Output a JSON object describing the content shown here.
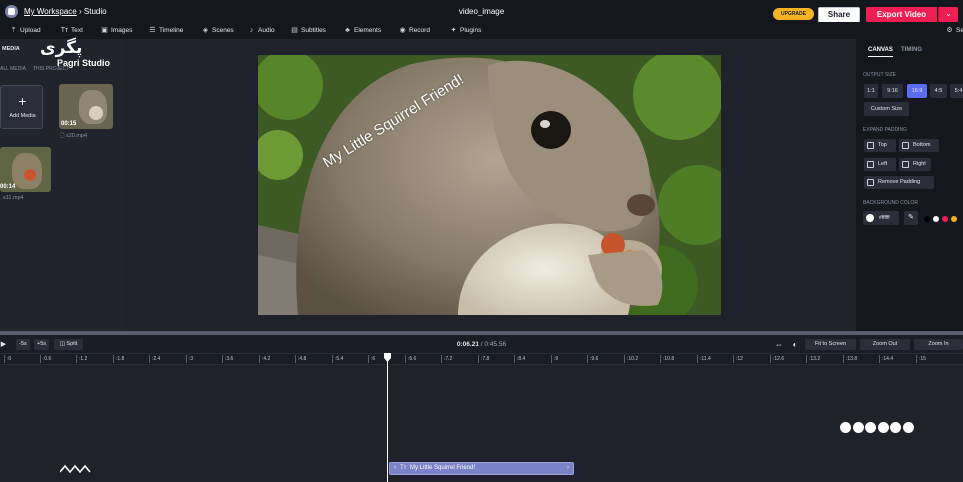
{
  "header": {
    "workspace_link": "My Workspace",
    "crumb_separator": "›",
    "crumb_current": "Studio",
    "document_title": "video_image",
    "upgrade_label": "UPGRADE",
    "share_label": "Share",
    "export_label": "Export Video",
    "export_dropdown": "⌄"
  },
  "toolbar": [
    {
      "id": "upload",
      "label": "Upload",
      "icon": "upload-icon",
      "glyph": "⤒"
    },
    {
      "id": "text",
      "label": "Text",
      "icon": "text-icon",
      "glyph": "Tт"
    },
    {
      "id": "images",
      "label": "Images",
      "icon": "images-icon",
      "glyph": "▣"
    },
    {
      "id": "timeline",
      "label": "Timeline",
      "icon": "timeline-icon",
      "glyph": "☰"
    },
    {
      "id": "scenes",
      "label": "Scenes",
      "icon": "scenes-icon",
      "glyph": "◈"
    },
    {
      "id": "audio",
      "label": "Audio",
      "icon": "music-note-icon",
      "glyph": "♪"
    },
    {
      "id": "subtitles",
      "label": "Subtitles",
      "icon": "subtitles-icon",
      "glyph": "▤"
    },
    {
      "id": "elements",
      "label": "Elements",
      "icon": "elements-icon",
      "glyph": "♣"
    },
    {
      "id": "record",
      "label": "Record",
      "icon": "record-icon",
      "glyph": "◉"
    },
    {
      "id": "plugins",
      "label": "Plugins",
      "icon": "plugins-icon",
      "glyph": "✦"
    },
    {
      "id": "settings",
      "label": "Se",
      "icon": "gear-icon",
      "glyph": "⚙"
    }
  ],
  "media": {
    "tab_media": "MEDIA",
    "filter_all": "ALL MEDIA",
    "filter_project": "THIS PROJECT",
    "add_media_label": "Add Media",
    "add_media_icon": "plus-icon",
    "items": [
      {
        "name": "s20.mp4",
        "duration": "00:15"
      },
      {
        "name": "s11.mp4",
        "duration": "00:14"
      }
    ]
  },
  "canvas": {
    "overlay_text": "My Little Squirrel Friend!"
  },
  "right_panel": {
    "tab_canvas": "CANVAS",
    "tab_timing": "TIMING",
    "output_size_label": "OUTPUT SIZE",
    "sizes": [
      "1:1",
      "9:16",
      "16:9",
      "4:5",
      "5:4"
    ],
    "active_size": "16:9",
    "custom_size_label": "Custom Size",
    "expand_padding_label": "EXPAND PADDING",
    "pad_top": "Top",
    "pad_bottom": "Bottom",
    "pad_left": "Left",
    "pad_right": "Right",
    "remove_padding": "Remove Padding",
    "bg_color_label": "BACKGROUND COLOR",
    "bg_color_value": "#ffffff",
    "preset_colors": [
      "#000000",
      "#ffffff",
      "#ee1d52",
      "#f5b324"
    ]
  },
  "timeline": {
    "back5": "-5s",
    "fwd5": "+5s",
    "split": "Split",
    "current_time": "0:06.21",
    "time_separator": "/",
    "total_time": "0:45.56",
    "fit_to_screen": "Fit to Screen",
    "zoom_out": "Zoom Out",
    "zoom_in": "Zoom In",
    "ticks": [
      ":0",
      ":0.6",
      ":1.2",
      ":1.8",
      ":2.4",
      ":3",
      ":3.6",
      ":4.2",
      ":4.8",
      ":5.4",
      ":6",
      ":6.6",
      ":7.2",
      ":7.8",
      ":8.4",
      ":9",
      ":9.6",
      ":10.2",
      ":10.8",
      ":11.4",
      ":12",
      ":12.6",
      ":13.2",
      ":13.8",
      ":14.4",
      ":15"
    ],
    "text_clip_label": "My Little Squirrel Friend!"
  },
  "watermark": {
    "glyph": "پگری",
    "text": "Pagri Studio"
  },
  "colors": {
    "accent_export": "#ee1d52",
    "accent_upgrade": "#f5b324",
    "active_size": "#5a6cf0",
    "text_clip": "#7c82c7"
  }
}
